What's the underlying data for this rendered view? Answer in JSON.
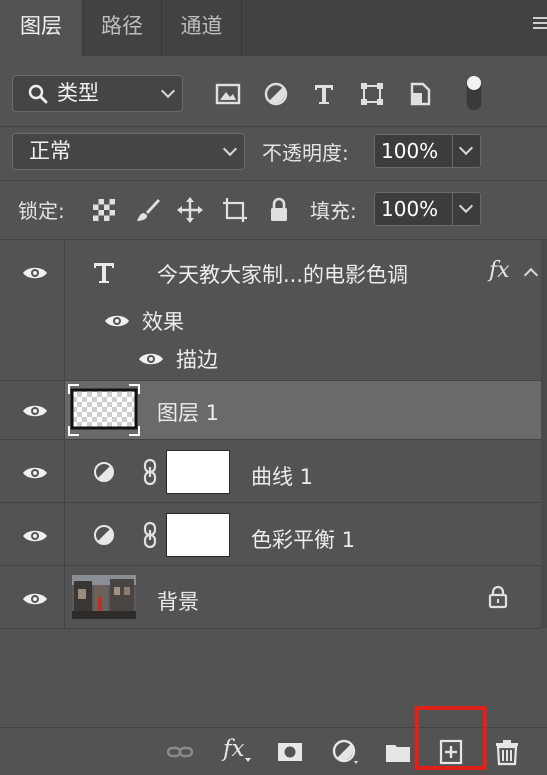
{
  "tabs": [
    {
      "label": "图层",
      "active": true
    },
    {
      "label": "路径",
      "active": false
    },
    {
      "label": "通道",
      "active": false
    }
  ],
  "filter": {
    "kind_label": "类型"
  },
  "blend": {
    "mode": "正常",
    "opacity_label": "不透明度:",
    "opacity": "100%"
  },
  "lock": {
    "label": "锁定:",
    "fill_label": "填充:",
    "fill": "100%"
  },
  "layers": {
    "text_layer": {
      "name": "今天教大家制...的电影色调",
      "fx": "fx",
      "effects_label": "效果",
      "stroke_label": "描边"
    },
    "layer1": {
      "name": "图层 1"
    },
    "curves": {
      "name": "曲线 1"
    },
    "color_balance": {
      "name": "色彩平衡 1"
    },
    "background": {
      "name": "背景"
    }
  },
  "bottom_fx_label": "fx",
  "colors": {
    "panel": "#535353",
    "tabbar": "#424242",
    "selected_row": "#6a6a6a",
    "highlight": "#e0201a"
  }
}
